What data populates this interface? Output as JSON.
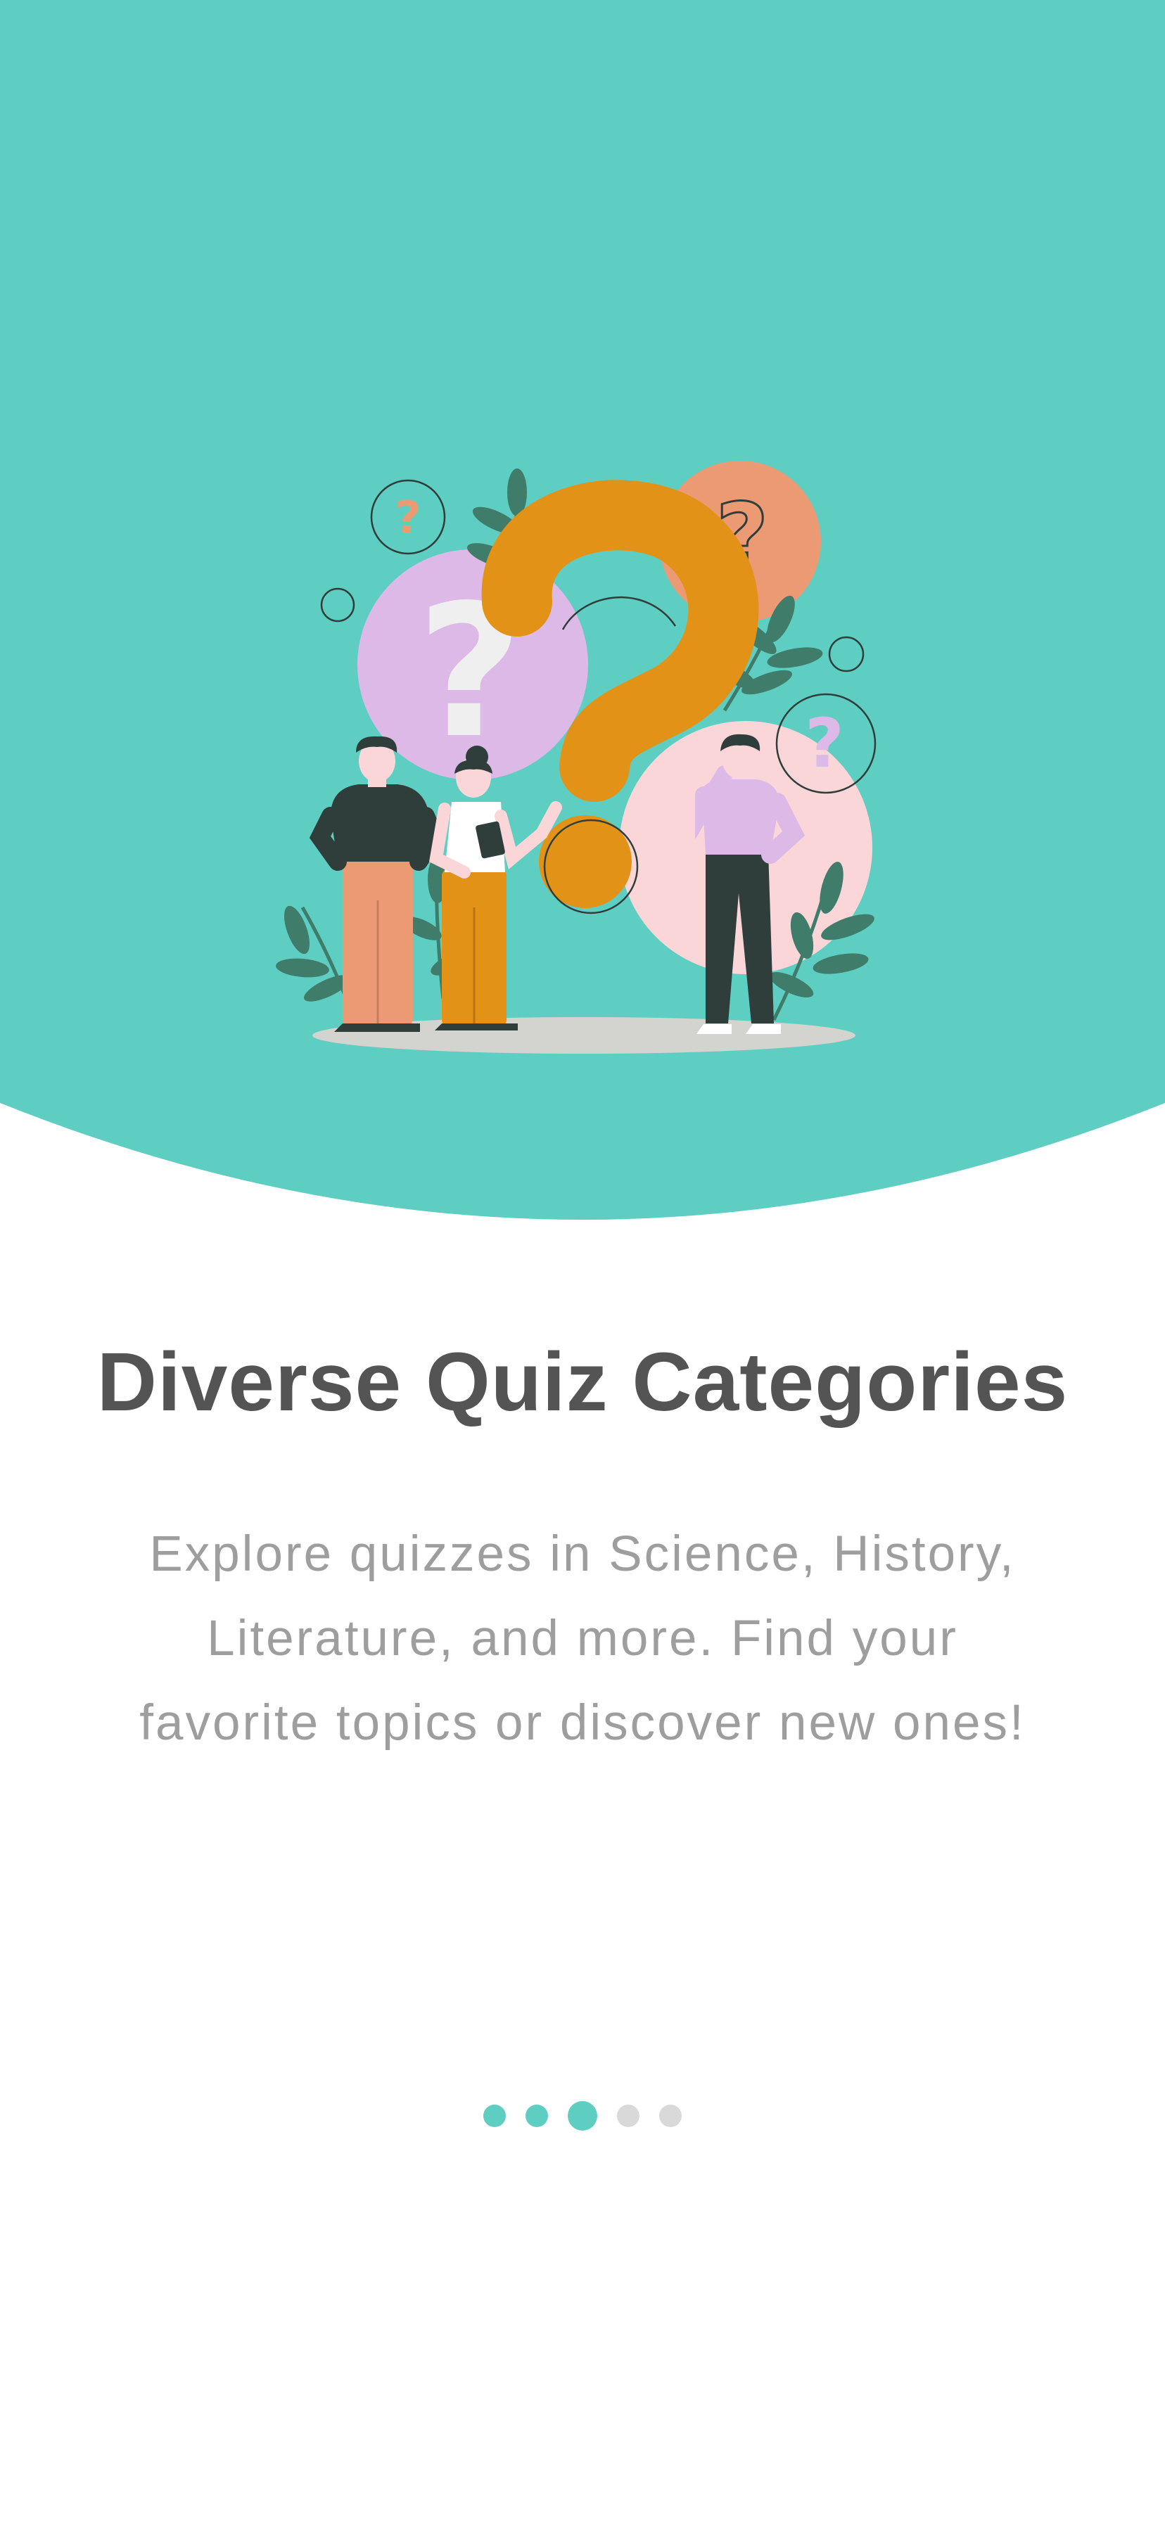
{
  "onboarding": {
    "title": "Diverse Quiz Categories",
    "description_lines": [
      "Explore quizzes in Science, History,",
      "Literature, and more. Find your",
      "favorite topics or discover new ones!"
    ],
    "pagination": {
      "total_pages": 5,
      "current_page": 3,
      "pages": [
        {
          "state": "visited"
        },
        {
          "state": "visited"
        },
        {
          "state": "active"
        },
        {
          "state": "inactive"
        },
        {
          "state": "inactive"
        }
      ]
    }
  },
  "illustration": {
    "subject": "three people standing around large question marks"
  },
  "colors": {
    "brand_teal": "#5ecec2",
    "title_text": "#545454",
    "body_text": "#9e9e9e",
    "dot_inactive": "#d9d9d9",
    "accent_orange": "#e29317",
    "accent_salmon": "#ec9a73",
    "accent_lavender": "#dcb9e6",
    "accent_pink": "#fad6d9",
    "leaf_green": "#3f7d6a"
  }
}
